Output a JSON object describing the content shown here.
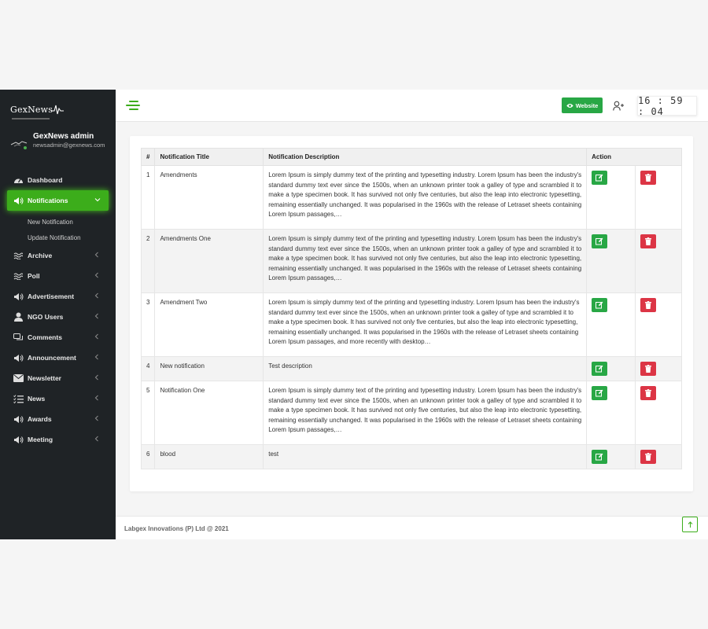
{
  "brand": {
    "name": "GexNews"
  },
  "user": {
    "name": "GexNews admin",
    "email": "newsadmin@gexnews.com"
  },
  "sidebar": {
    "items": [
      {
        "label": "Dashboard",
        "icon": "dashboard-icon"
      },
      {
        "label": "Notifications",
        "icon": "megaphone-icon",
        "active": true,
        "children": [
          {
            "label": "New Notification"
          },
          {
            "label": "Update Notification"
          }
        ]
      },
      {
        "label": "Archive",
        "icon": "waves-icon"
      },
      {
        "label": "Poll",
        "icon": "waves-icon"
      },
      {
        "label": "Advertisement",
        "icon": "megaphone-icon"
      },
      {
        "label": "NGO Users",
        "icon": "users-icon"
      },
      {
        "label": "Comments",
        "icon": "comments-icon"
      },
      {
        "label": "Announcement",
        "icon": "megaphone-icon"
      },
      {
        "label": "Newsletter",
        "icon": "envelope-icon"
      },
      {
        "label": "News",
        "icon": "list-icon"
      },
      {
        "label": "Awards",
        "icon": "megaphone-icon"
      },
      {
        "label": "Meeting",
        "icon": "megaphone-icon"
      }
    ]
  },
  "topbar": {
    "website_label": "Website",
    "clock": "16:59:04"
  },
  "table": {
    "headers": [
      "#",
      "Notification Title",
      "Notification Description",
      "Action"
    ],
    "rows": [
      {
        "num": "1",
        "title": "Amendments",
        "desc": "Lorem Ipsum is simply dummy text of the printing and typesetting industry. Lorem Ipsum has been the industry's standard dummy text ever since the 1500s, when an unknown printer took a galley of type and scrambled it to make a type specimen book. It has survived not only five centuries, but also the leap into electronic typesetting, remaining essentially unchanged. It was popularised in the 1960s with the release of Letraset sheets containing Lorem Ipsum passages,…"
      },
      {
        "num": "2",
        "title": "Amendments One",
        "desc": "Lorem Ipsum is simply dummy text of the printing and typesetting industry. Lorem Ipsum has been the industry's standard dummy text ever since the 1500s, when an unknown printer took a galley of type and scrambled it to make a type specimen book. It has survived not only five centuries, but also the leap into electronic typesetting, remaining essentially unchanged. It was popularised in the 1960s with the release of Letraset sheets containing Lorem Ipsum passages,…"
      },
      {
        "num": "3",
        "title": "Amendment Two",
        "desc": "Lorem Ipsum is simply dummy text of the printing and typesetting industry. Lorem Ipsum has been the industry's standard dummy text ever since the 1500s, when an unknown printer took a galley of type and scrambled it to make a type specimen book. It has survived not only five centuries, but also the leap into electronic typesetting, remaining essentially unchanged. It was popularised in the 1960s with the release of Letraset sheets containing Lorem Ipsum passages, and more recently with desktop…"
      },
      {
        "num": "4",
        "title": "New notification",
        "desc": "Test description"
      },
      {
        "num": "5",
        "title": "Notification One",
        "desc": "Lorem Ipsum is simply dummy text of the printing and typesetting industry. Lorem Ipsum has been the industry's standard dummy text ever since the 1500s, when an unknown printer took a galley of type and scrambled it to make a type specimen book. It has survived not only five centuries, but also the leap into electronic typesetting, remaining essentially unchanged. It was popularised in the 1960s with the release of Letraset sheets containing Lorem Ipsum passages,…"
      },
      {
        "num": "6",
        "title": "blood",
        "desc": "test"
      }
    ]
  },
  "footer": {
    "text": "Labgex Innovations (P) Ltd @ 2021"
  },
  "colors": {
    "accent": "#3cad1b",
    "sidebar_bg": "#1f2326",
    "edit": "#28a745",
    "delete": "#dc3545"
  }
}
